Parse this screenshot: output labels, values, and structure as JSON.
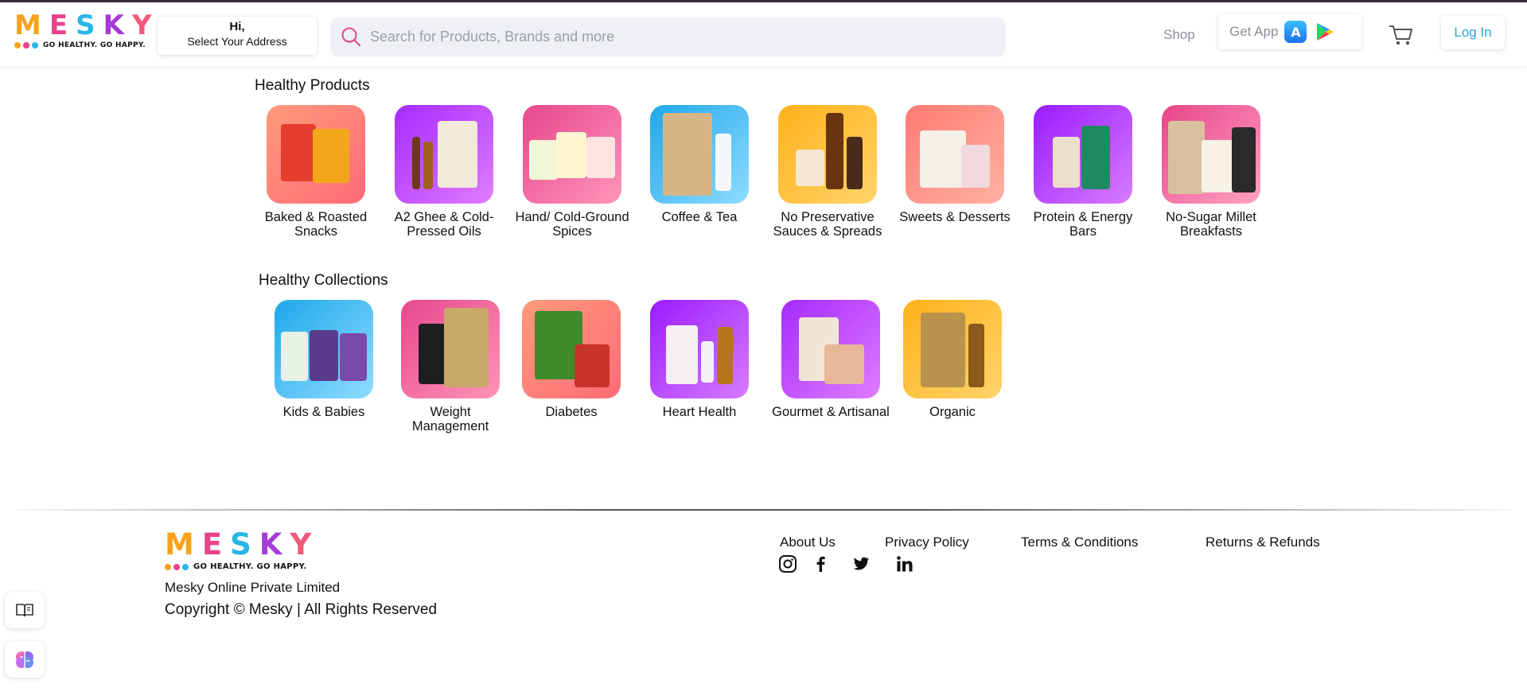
{
  "brand": {
    "name": "MESKY",
    "letters": [
      "M",
      "E",
      "S",
      "K",
      "Y"
    ],
    "tagline": "GO HEALTHY. GO HAPPY."
  },
  "header": {
    "address_greeting": "Hi,",
    "address_prompt": "Select Your Address",
    "search_placeholder": "Search for Products, Brands and more",
    "shop_label": "Shop",
    "get_app_label": "Get App",
    "login_label": "Log In"
  },
  "healthy_products": {
    "title": "Healthy Products",
    "items": [
      {
        "label": "Baked & Roasted Snacks"
      },
      {
        "label": "A2 Ghee & Cold-Pressed Oils"
      },
      {
        "label": "Hand/ Cold-Ground Spices"
      },
      {
        "label": "Coffee & Tea"
      },
      {
        "label": "No Preservative Sauces & Spreads"
      },
      {
        "label": "Sweets & Desserts"
      },
      {
        "label": "Protein & Energy Bars"
      },
      {
        "label": "No-Sugar Millet Breakfasts"
      }
    ]
  },
  "healthy_collections": {
    "title": "Healthy Collections",
    "items": [
      {
        "label": "Kids & Babies"
      },
      {
        "label": "Weight Management"
      },
      {
        "label": "Diabetes"
      },
      {
        "label": "Heart Health"
      },
      {
        "label": "Gourmet & Artisanal"
      },
      {
        "label": "Organic"
      }
    ]
  },
  "footer": {
    "company": "Mesky Online Private Limited",
    "copyright": "Copyright © Mesky | All Rights Reserved",
    "links": {
      "about": "About Us",
      "privacy": "Privacy Policy",
      "terms": "Terms & Conditions",
      "returns": "Returns & Refunds"
    }
  },
  "colors": {
    "accent": "#2aa7d8",
    "brand_orange": "#f7a21b",
    "brand_pink": "#e8438a",
    "brand_blue": "#29b6e8",
    "brand_purple": "#a53bd8"
  }
}
